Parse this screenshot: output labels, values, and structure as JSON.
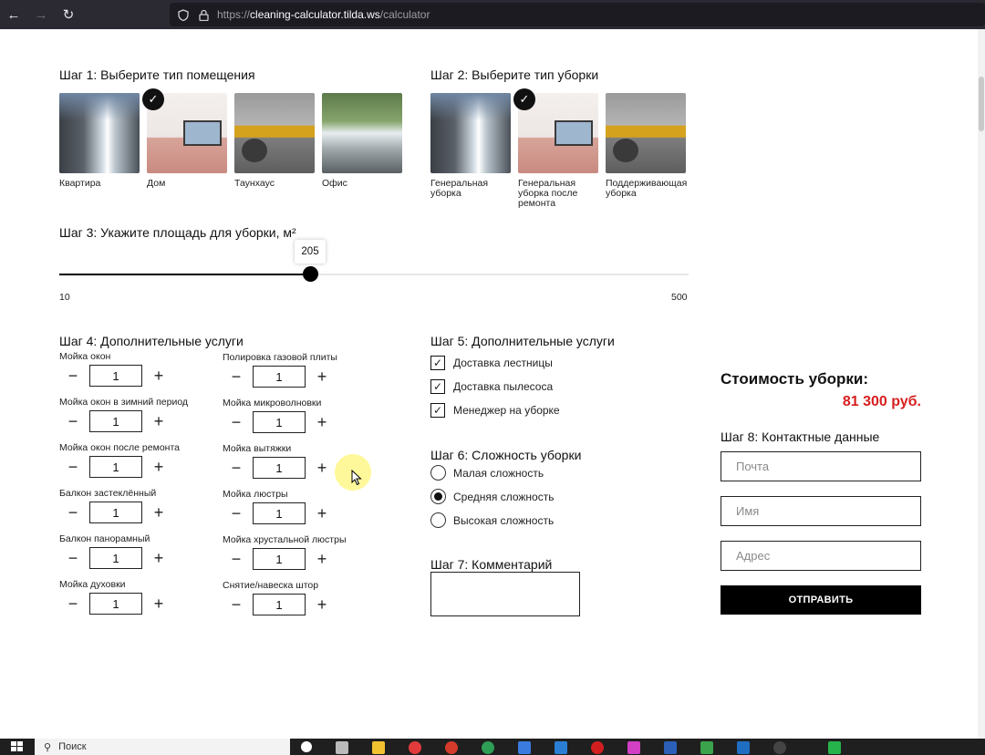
{
  "browser": {
    "url_prefix": "https://",
    "url_host": "cleaning-calculator.tilda.ws",
    "url_path": "/calculator"
  },
  "step1": {
    "title": "Шаг 1: Выберите тип помещения",
    "options": [
      {
        "label": "Квартира",
        "selected": false
      },
      {
        "label": "Дом",
        "selected": true
      },
      {
        "label": "Таунхаус",
        "selected": false
      },
      {
        "label": "Офис",
        "selected": false
      }
    ]
  },
  "step2": {
    "title": "Шаг 2: Выберите тип уборки",
    "options": [
      {
        "label": "Генеральная уборка",
        "selected": false
      },
      {
        "label": "Генеральная уборка после ремонта",
        "selected": true
      },
      {
        "label": "Поддерживающая уборка",
        "selected": false
      }
    ]
  },
  "step3": {
    "title": "Шаг 3: Укажите площадь для уборки, м²",
    "min": 10,
    "max": 500,
    "value": 205,
    "min_label": "10",
    "max_label": "500",
    "value_label": "205"
  },
  "step4": {
    "title": "Шаг 4: Дополнительные услуги",
    "left": [
      {
        "label": "Мойка окон",
        "value": "1"
      },
      {
        "label": "Мойка окон в зимний период",
        "value": "1"
      },
      {
        "label": "Мойка окон после ремонта",
        "value": "1"
      },
      {
        "label": "Балкон застеклённый",
        "value": "1"
      },
      {
        "label": "Балкон панорамный",
        "value": "1"
      },
      {
        "label": "Мойка духовки",
        "value": "1"
      }
    ],
    "right": [
      {
        "label": "Полировка газовой плиты",
        "value": "1"
      },
      {
        "label": "Мойка микроволновки",
        "value": "1"
      },
      {
        "label": "Мойка вытяжки",
        "value": "1"
      },
      {
        "label": "Мойка люстры",
        "value": "1"
      },
      {
        "label": "Мойка хрустальной люстры",
        "value": "1"
      },
      {
        "label": "Снятие/навеска штор",
        "value": "1"
      }
    ],
    "minus": "−",
    "plus": "+"
  },
  "step5": {
    "title": "Шаг 5: Дополнительные услуги",
    "items": [
      {
        "label": "Доставка лестницы",
        "checked": true
      },
      {
        "label": "Доставка пылесоса",
        "checked": true
      },
      {
        "label": "Менеджер на уборке",
        "checked": true
      }
    ]
  },
  "step6": {
    "title": "Шаг 6: Сложность уборки",
    "items": [
      {
        "label": "Малая сложность",
        "selected": false
      },
      {
        "label": "Средняя сложность",
        "selected": true
      },
      {
        "label": "Высокая сложность",
        "selected": false
      }
    ]
  },
  "step7": {
    "title": "Шаг 7: Комментарий"
  },
  "cost": {
    "title": "Стоимость уборки:",
    "value": "81 300 руб."
  },
  "step8": {
    "title": "Шаг 8: Контактные данные",
    "email_placeholder": "Почта",
    "name_placeholder": "Имя",
    "address_placeholder": "Адрес",
    "submit_label": "ОТПРАВИТЬ"
  },
  "taskbar": {
    "search_placeholder": "Поиск"
  },
  "colors": {
    "accent_price": "#d71f1f",
    "submit_bg": "#000000"
  }
}
